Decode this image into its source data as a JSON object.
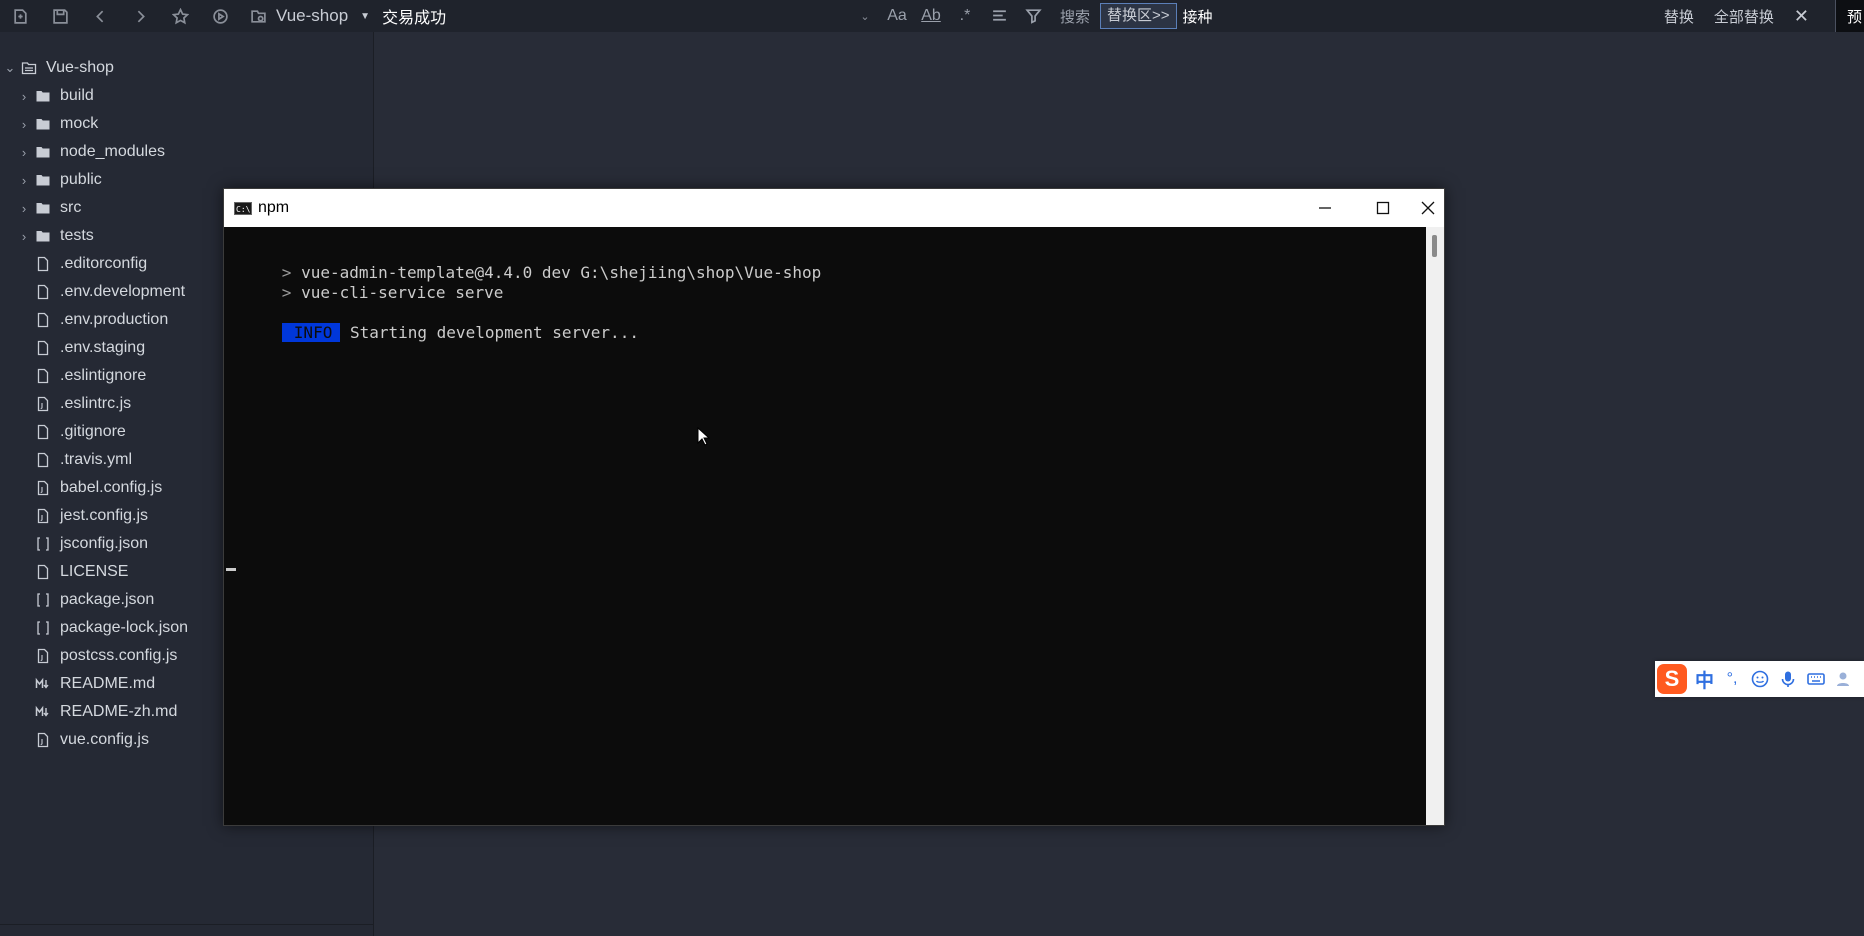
{
  "toolbar": {
    "project_name": "Vue-shop",
    "search_text": "交易成功",
    "search_label": "搜索",
    "replace_label": "替换区>>",
    "replace_text": "接种",
    "replace_button": "替换",
    "replace_all_button": "全部替换",
    "preview_label": "预",
    "match_case_label": "Aa",
    "whole_word_label": "Ab"
  },
  "sidebar": {
    "root": "Vue-shop",
    "folders": [
      "build",
      "mock",
      "node_modules",
      "public",
      "src",
      "tests"
    ],
    "files": [
      {
        "name": ".editorconfig",
        "icon": "file-icon"
      },
      {
        "name": ".env.development",
        "icon": "file-icon"
      },
      {
        "name": ".env.production",
        "icon": "file-icon"
      },
      {
        "name": ".env.staging",
        "icon": "file-icon"
      },
      {
        "name": ".eslintignore",
        "icon": "file-icon"
      },
      {
        "name": ".eslintrc.js",
        "icon": "js-file-icon"
      },
      {
        "name": ".gitignore",
        "icon": "file-icon"
      },
      {
        "name": ".travis.yml",
        "icon": "file-icon"
      },
      {
        "name": "babel.config.js",
        "icon": "js-file-icon"
      },
      {
        "name": "jest.config.js",
        "icon": "js-file-icon"
      },
      {
        "name": "jsconfig.json",
        "icon": "json-file-icon"
      },
      {
        "name": "LICENSE",
        "icon": "file-icon"
      },
      {
        "name": "package.json",
        "icon": "json-file-icon"
      },
      {
        "name": "package-lock.json",
        "icon": "json-file-icon"
      },
      {
        "name": "postcss.config.js",
        "icon": "js-file-icon"
      },
      {
        "name": "README.md",
        "icon": "markdown-file-icon"
      },
      {
        "name": "README-zh.md",
        "icon": "markdown-file-icon"
      },
      {
        "name": "vue.config.js",
        "icon": "js-file-icon"
      }
    ]
  },
  "console": {
    "title": "npm",
    "lines": [
      "vue-admin-template@4.4.0 dev G:\\shejiing\\shop\\Vue-shop",
      "vue-cli-service serve"
    ],
    "info_badge": "INFO",
    "info_message": "Starting development server..."
  },
  "ime": {
    "logo": "S",
    "mode": "中",
    "punct": "°,"
  },
  "colors": {
    "info_badge_bg": "#0037da",
    "ime_logo": "#ff5a1f",
    "ime_icons": "#2f6fe0",
    "editor_bg": "#282c37"
  }
}
